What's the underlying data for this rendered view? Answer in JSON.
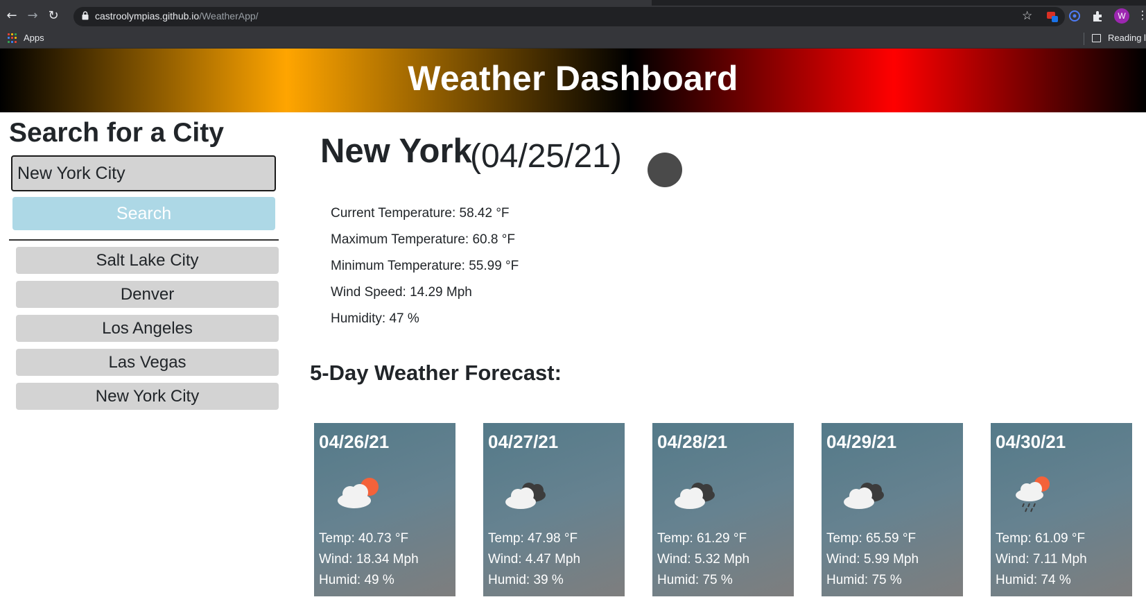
{
  "browser": {
    "url_host": "castroolympias.github.io",
    "url_path": "/WeatherApp/",
    "bookmarks": {
      "apps_label": "Apps",
      "reading_list_label": "Reading list"
    },
    "profile_initial": "W",
    "icons": [
      "back-arrow-icon",
      "forward-arrow-icon",
      "reload-icon",
      "lock-icon",
      "star-icon",
      "extensions-icon",
      "menu-icon"
    ]
  },
  "header": {
    "title": "Weather Dashboard"
  },
  "sidebar": {
    "heading": "Search for a City",
    "search_value": "New York City",
    "search_button": "Search",
    "history": [
      {
        "label": "Salt Lake City"
      },
      {
        "label": "Denver"
      },
      {
        "label": "Los Angeles"
      },
      {
        "label": "Las Vegas"
      },
      {
        "label": "New York City"
      }
    ]
  },
  "current": {
    "city": "New York",
    "date": "(04/25/21)",
    "icon": "weather-icon",
    "details": [
      {
        "text": "Current Temperature: 58.42 °F"
      },
      {
        "text": "Maximum Temperature: 60.8 °F"
      },
      {
        "text": "Minimum Temperature: 55.99 °F"
      },
      {
        "text": "Wind Speed: 14.29 Mph"
      },
      {
        "text": "Humidity: 47 %"
      }
    ]
  },
  "forecast": {
    "heading": "5-Day Weather Forecast:",
    "days": [
      {
        "date": "04/26/21",
        "icon": "partly-cloudy-icon",
        "temp": "Temp: 40.73 °F",
        "wind": "Wind: 18.34 Mph",
        "humid": "Humid: 49 %"
      },
      {
        "date": "04/27/21",
        "icon": "broken-clouds-icon",
        "temp": "Temp: 47.98 °F",
        "wind": "Wind: 4.47 Mph",
        "humid": "Humid: 39 %"
      },
      {
        "date": "04/28/21",
        "icon": "broken-clouds-icon",
        "temp": "Temp: 61.29 °F",
        "wind": "Wind: 5.32 Mph",
        "humid": "Humid: 75 %"
      },
      {
        "date": "04/29/21",
        "icon": "broken-clouds-icon",
        "temp": "Temp: 65.59 °F",
        "wind": "Wind: 5.99 Mph",
        "humid": "Humid: 75 %"
      },
      {
        "date": "04/30/21",
        "icon": "rain-icon",
        "temp": "Temp: 61.09 °F",
        "wind": "Wind: 7.11 Mph",
        "humid": "Humid: 74 %"
      }
    ]
  },
  "colors": {
    "banner_gradient": [
      "#000000",
      "#ffa500",
      "#000000",
      "#ff0000",
      "#000000"
    ],
    "search_button_bg": "#add8e6",
    "input_bg": "#d3d3d3",
    "card_bg": "#5f7d8a"
  }
}
